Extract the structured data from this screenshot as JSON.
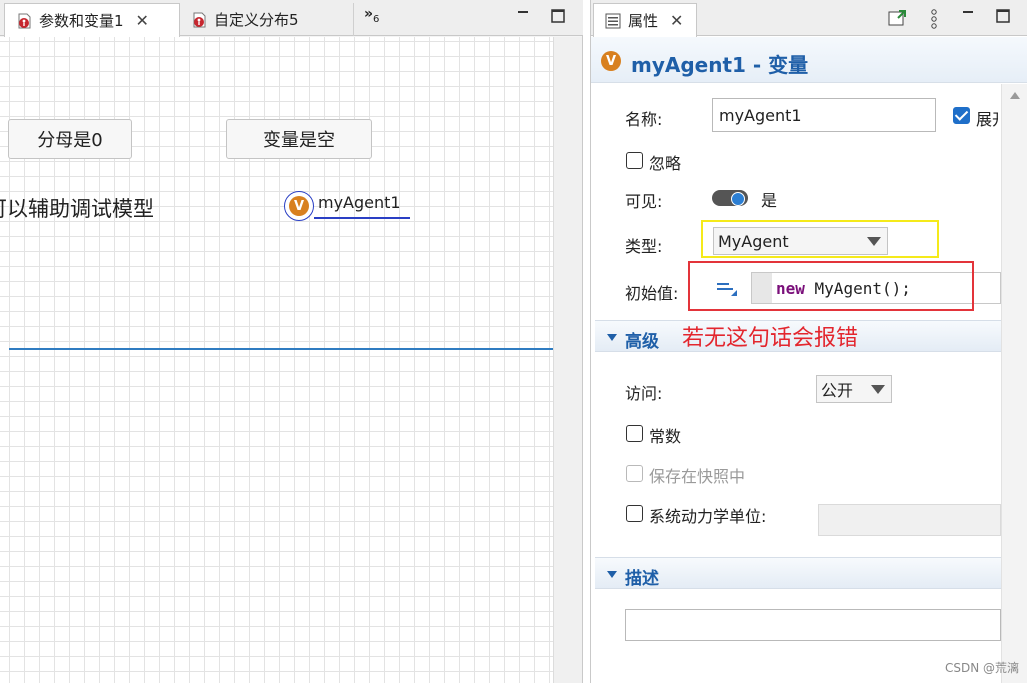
{
  "left_tabs": {
    "tab1_label": "参数和变量1",
    "tab2_label": "自定义分布5",
    "overflow_glyph": "»",
    "overflow_count": "6"
  },
  "canvas": {
    "button1_label": "分母是0",
    "button2_label": "变量是空",
    "static_text": "可以辅助调试模型",
    "agent_badge": "V",
    "agent_label": "myAgent1"
  },
  "right_tab": {
    "label": "属性"
  },
  "props": {
    "badge": "V",
    "title": "myAgent1 - 变量",
    "name_label": "名称:",
    "name_value": "myAgent1",
    "expand_label": "展开",
    "ignore_label": "忽略",
    "visible_label": "可见:",
    "visible_value": "是",
    "type_label": "类型:",
    "type_value": "MyAgent",
    "init_label": "初始值:",
    "init_keyword": "new",
    "init_rest": " MyAgent();",
    "annotation": "若无这句话会报错"
  },
  "advanced": {
    "title": "高级",
    "access_label": "访问:",
    "access_value": "公开",
    "constant_label": "常数",
    "snapshot_label": "保存在快照中",
    "sd_units_label": "系统动力学单位:"
  },
  "description": {
    "title": "描述"
  },
  "watermark": "CSDN @荒漓",
  "colors": {
    "accent_blue": "#1f5fa8",
    "annotation_red": "#e3262e",
    "highlight_yellow": "#f5ea1a",
    "agent_orange": "#d8801f"
  }
}
